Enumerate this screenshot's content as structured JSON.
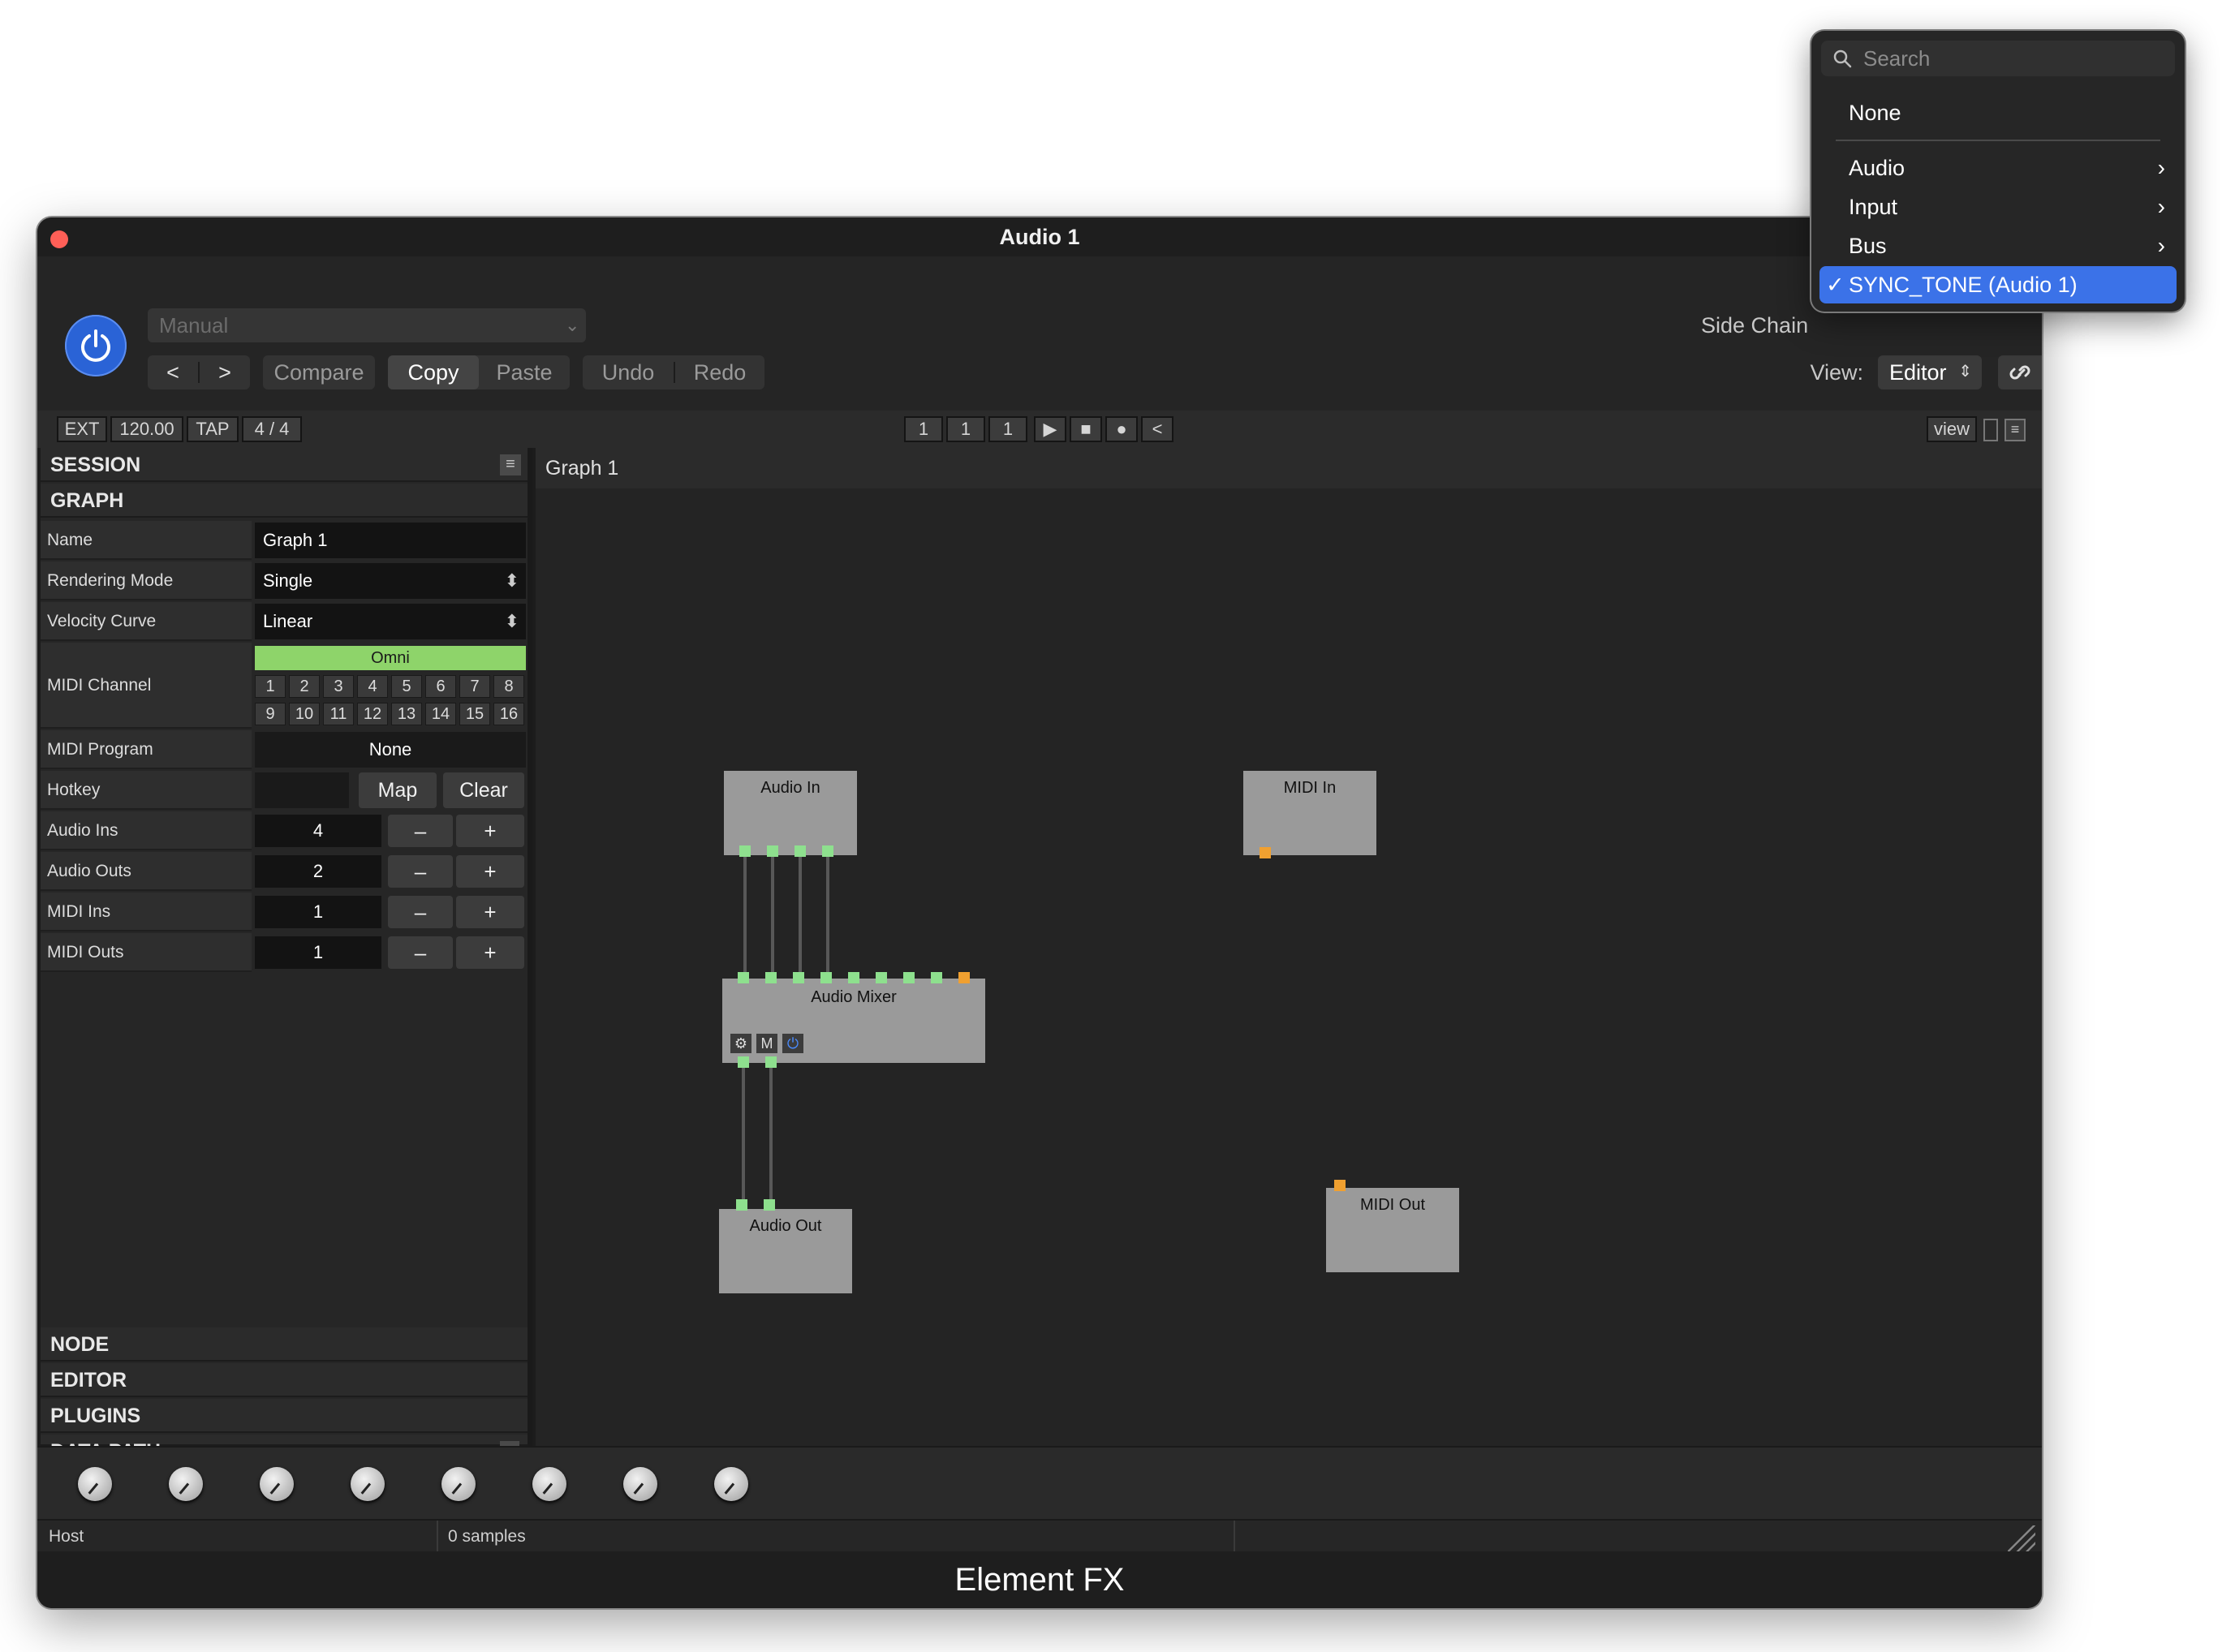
{
  "window": {
    "title": "Audio 1",
    "footer": "Element FX"
  },
  "header": {
    "preset_placeholder": "Manual",
    "compare": "Compare",
    "copy": "Copy",
    "paste": "Paste",
    "undo": "Undo",
    "redo": "Redo",
    "side_chain_label": "Side Chain",
    "view_label": "View:",
    "view_value": "Editor"
  },
  "transport": {
    "ext": "EXT",
    "tempo": "120.00",
    "tap": "TAP",
    "meter": "4 / 4",
    "bar": "1",
    "beat": "1",
    "tick": "1",
    "view_button": "view"
  },
  "sidebar": {
    "session": "SESSION",
    "graph": "GRAPH",
    "props": {
      "name_label": "Name",
      "name_value": "Graph 1",
      "rendering_label": "Rendering Mode",
      "rendering_value": "Single",
      "velocity_label": "Velocity Curve",
      "velocity_value": "Linear",
      "midi_channel_label": "MIDI Channel",
      "omni": "Omni",
      "channels": [
        "1",
        "2",
        "3",
        "4",
        "5",
        "6",
        "7",
        "8",
        "9",
        "10",
        "11",
        "12",
        "13",
        "14",
        "15",
        "16"
      ],
      "midi_program_label": "MIDI Program",
      "midi_program_value": "None",
      "hotkey_label": "Hotkey",
      "map": "Map",
      "clear": "Clear",
      "audio_ins_label": "Audio Ins",
      "audio_ins_value": "4",
      "audio_outs_label": "Audio Outs",
      "audio_outs_value": "2",
      "midi_ins_label": "MIDI Ins",
      "midi_ins_value": "1",
      "midi_outs_label": "MIDI Outs",
      "midi_outs_value": "1",
      "minus": "–",
      "plus": "+"
    },
    "node": "NODE",
    "editor": "EDITOR",
    "plugins": "PLUGINS",
    "data_path": "DATA PATH"
  },
  "graph": {
    "title": "Graph 1",
    "nodes": {
      "audio_in": "Audio In",
      "midi_in": "MIDI In",
      "audio_mixer": "Audio Mixer",
      "audio_out": "Audio Out",
      "midi_out": "MIDI Out",
      "mute": "M"
    }
  },
  "status": {
    "host": "Host",
    "samples": "0 samples"
  },
  "menu": {
    "search_placeholder": "Search",
    "none": "None",
    "audio": "Audio",
    "input": "Input",
    "bus": "Bus",
    "selected": "SYNC_TONE (Audio 1)"
  },
  "colors": {
    "accent": "#3b72e8",
    "port_audio": "#8ee08e",
    "port_midi": "#f0a030",
    "close": "#ff5f57"
  }
}
